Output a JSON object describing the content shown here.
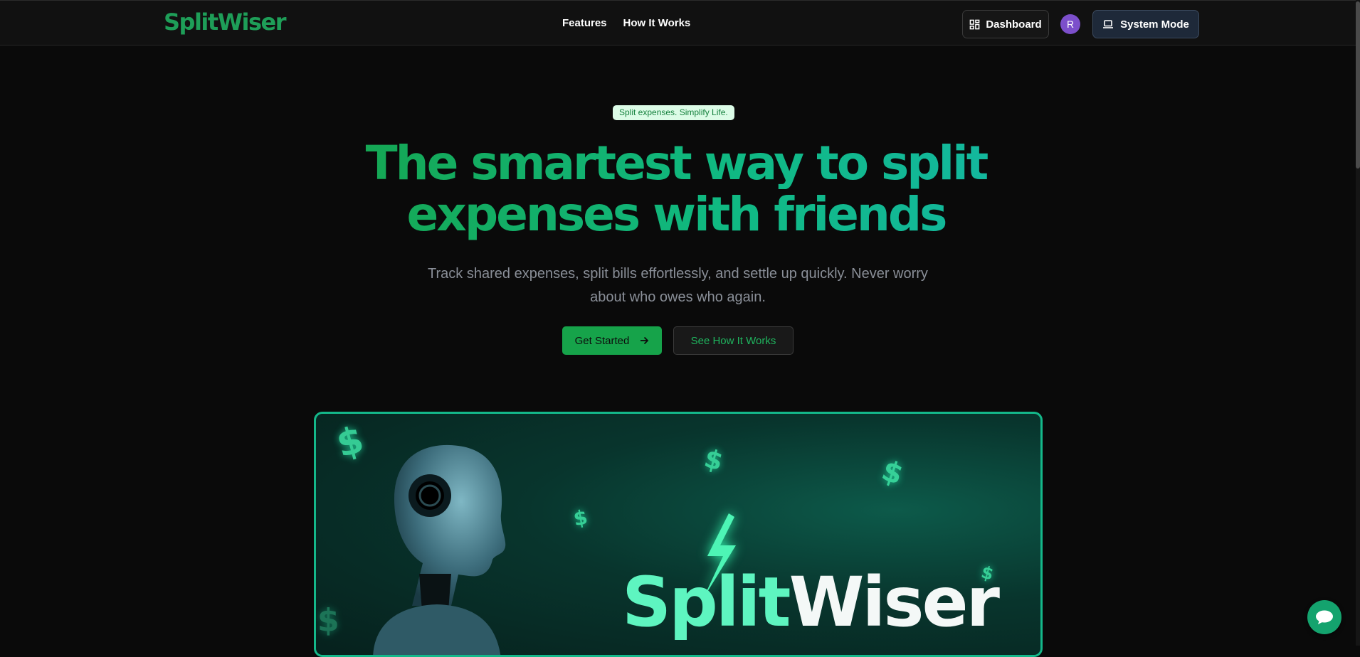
{
  "nav": {
    "logo": "SplitWiser",
    "links": [
      "Features",
      "How It Works"
    ],
    "dashboard_label": "Dashboard",
    "dashboard_icon": "layout-grid-icon",
    "avatar_initial": "R",
    "mode_label": "System Mode",
    "mode_icon": "laptop-icon"
  },
  "hero": {
    "badge": "Split expenses. Simplify Life.",
    "headline_line1": "The smartest way to split",
    "headline_line2": "expenses with friends",
    "subtitle": "Track shared expenses, split bills effortlessly, and settle up quickly. Never worry about who owes who again.",
    "primary_cta": "Get Started",
    "primary_cta_icon": "arrow-right-icon",
    "secondary_cta": "See How It Works"
  },
  "hero_image": {
    "brand_part1": "Split",
    "brand_part2": "Wiser",
    "currency_symbol": "$"
  },
  "chat": {
    "icon": "chat-bubble-icon"
  },
  "colors": {
    "background": "#0a0a0a",
    "accent": "#16a34a",
    "teal": "#14b8a6",
    "badge_bg": "#dcfce7",
    "avatar": "#7c4fcb"
  }
}
